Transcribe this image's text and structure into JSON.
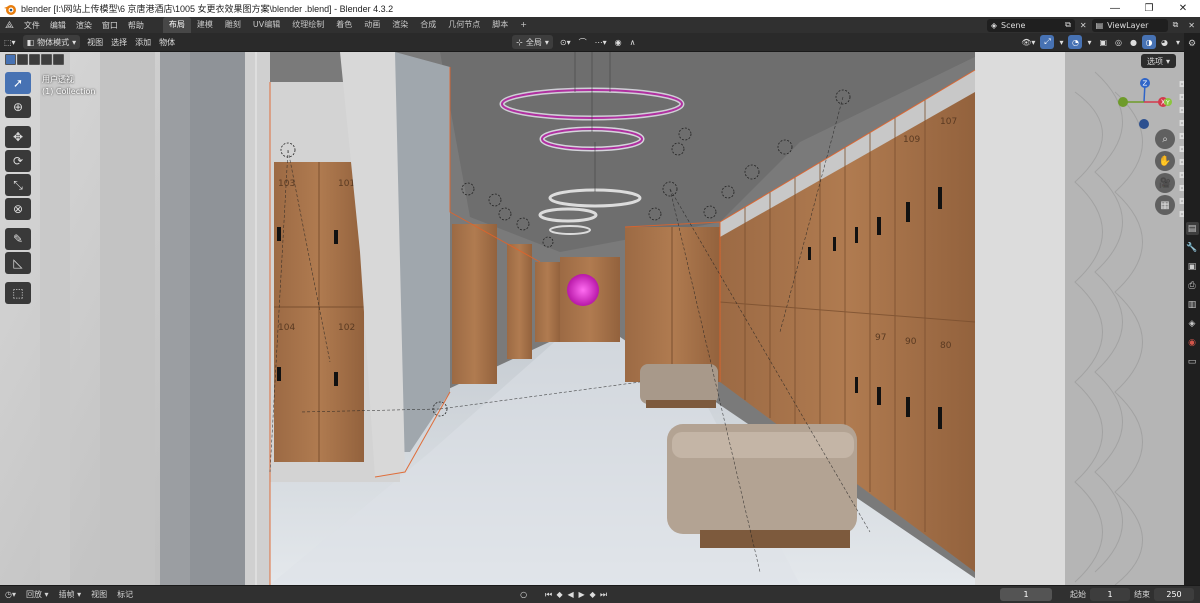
{
  "window": {
    "title": "blender  [I:\\网站上传模型\\6 京唐港酒店\\1005 女更衣效果图方案\\blender .blend] - Blender 4.3.2",
    "minimize": "—",
    "maximize": "❐",
    "close": "✕"
  },
  "menu": {
    "items": [
      "文件",
      "编辑",
      "渲染",
      "窗口",
      "帮助"
    ],
    "workspaces": [
      "布局",
      "建模",
      "雕刻",
      "UV编辑",
      "纹理绘制",
      "着色",
      "动画",
      "渲染",
      "合成",
      "几何节点",
      "脚本"
    ],
    "add_workspace": "+",
    "scene_label": "Scene",
    "view_layer_label": "ViewLayer"
  },
  "viewport_header": {
    "mode": "物体模式",
    "view": "视图",
    "select": "选择",
    "add": "添加",
    "object": "物体",
    "transform_orientation": "全局"
  },
  "viewport": {
    "view_name": "用户透视",
    "collection": "(1) Collection",
    "options_label": "选项",
    "gizmo": {
      "z": "Z",
      "x": "X",
      "y": "Y"
    },
    "locker_numbers": [
      "103",
      "101",
      "104",
      "102",
      "109",
      "107",
      "97",
      "90",
      "80"
    ]
  },
  "timeline": {
    "playback": "回放",
    "keying": "插帧",
    "view": "视图",
    "marker": "标记",
    "current_frame": "1",
    "start_label": "起始",
    "start_value": "1",
    "end_label": "结束",
    "end_value": "250"
  },
  "icons": {
    "toolbar": [
      "select-box-icon",
      "cursor-icon",
      "move-icon",
      "rotate-icon",
      "scale-icon",
      "transform-icon",
      "annotate-icon",
      "measure-icon",
      "add-cube-icon"
    ],
    "accent": "#4772b3"
  }
}
